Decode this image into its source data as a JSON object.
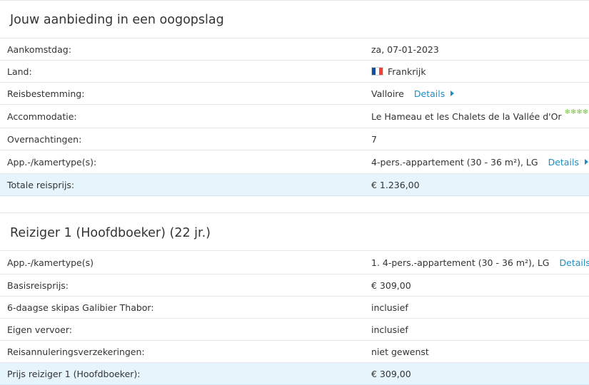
{
  "offer": {
    "title": "Jouw aanbieding in een oogopslag",
    "arrival": {
      "label": "Aankomstdag:",
      "value": "za, 07-01-2023"
    },
    "country": {
      "label": "Land:",
      "value": "Frankrijk",
      "flag_icon": "france-flag-icon",
      "flag_colors": [
        "#0055a4",
        "#ffffff",
        "#ef4135"
      ]
    },
    "destination": {
      "label": "Reisbestemming:",
      "value": "Valloire",
      "details": "Details"
    },
    "accommodation": {
      "label": "Accommodatie:",
      "value": "Le Hameau et les Chalets de la Vallée d'Or",
      "stars": "❄❄❄❄",
      "stars_color": "#7cc243"
    },
    "nights": {
      "label": "Overnachtingen:",
      "value": "7"
    },
    "room_type": {
      "label": "App.-/kamertype(s):",
      "value": "4-pers.-appartement (30 - 36 m²), LG",
      "details": "Details"
    },
    "total": {
      "label": "Totale reisprijs:",
      "value": "€ 1.236,00"
    }
  },
  "traveler": {
    "title": "Reiziger 1 (Hoofdboeker) (22 jr.)",
    "room_type": {
      "label": "App.-/kamertype(s)",
      "value": "1. 4-pers.-appartement (30 - 36 m²), LG",
      "details": "Details"
    },
    "base_price": {
      "label": "Basisreisprijs:",
      "value": "€ 309,00"
    },
    "skipass": {
      "label": "6-daagse skipas Galibier Thabor:",
      "value": "inclusief"
    },
    "transport": {
      "label": "Eigen vervoer:",
      "value": "inclusief"
    },
    "insurance": {
      "label": "Reisannuleringsverzekeringen:",
      "value": "niet gewenst"
    },
    "price": {
      "label": "Prijs reiziger 1 (Hoofdboeker):",
      "value": "€ 309,00"
    }
  },
  "colors": {
    "link": "#1a8fc4",
    "total_bg": "#e5f5fb",
    "divider": "#e6e6e6"
  }
}
